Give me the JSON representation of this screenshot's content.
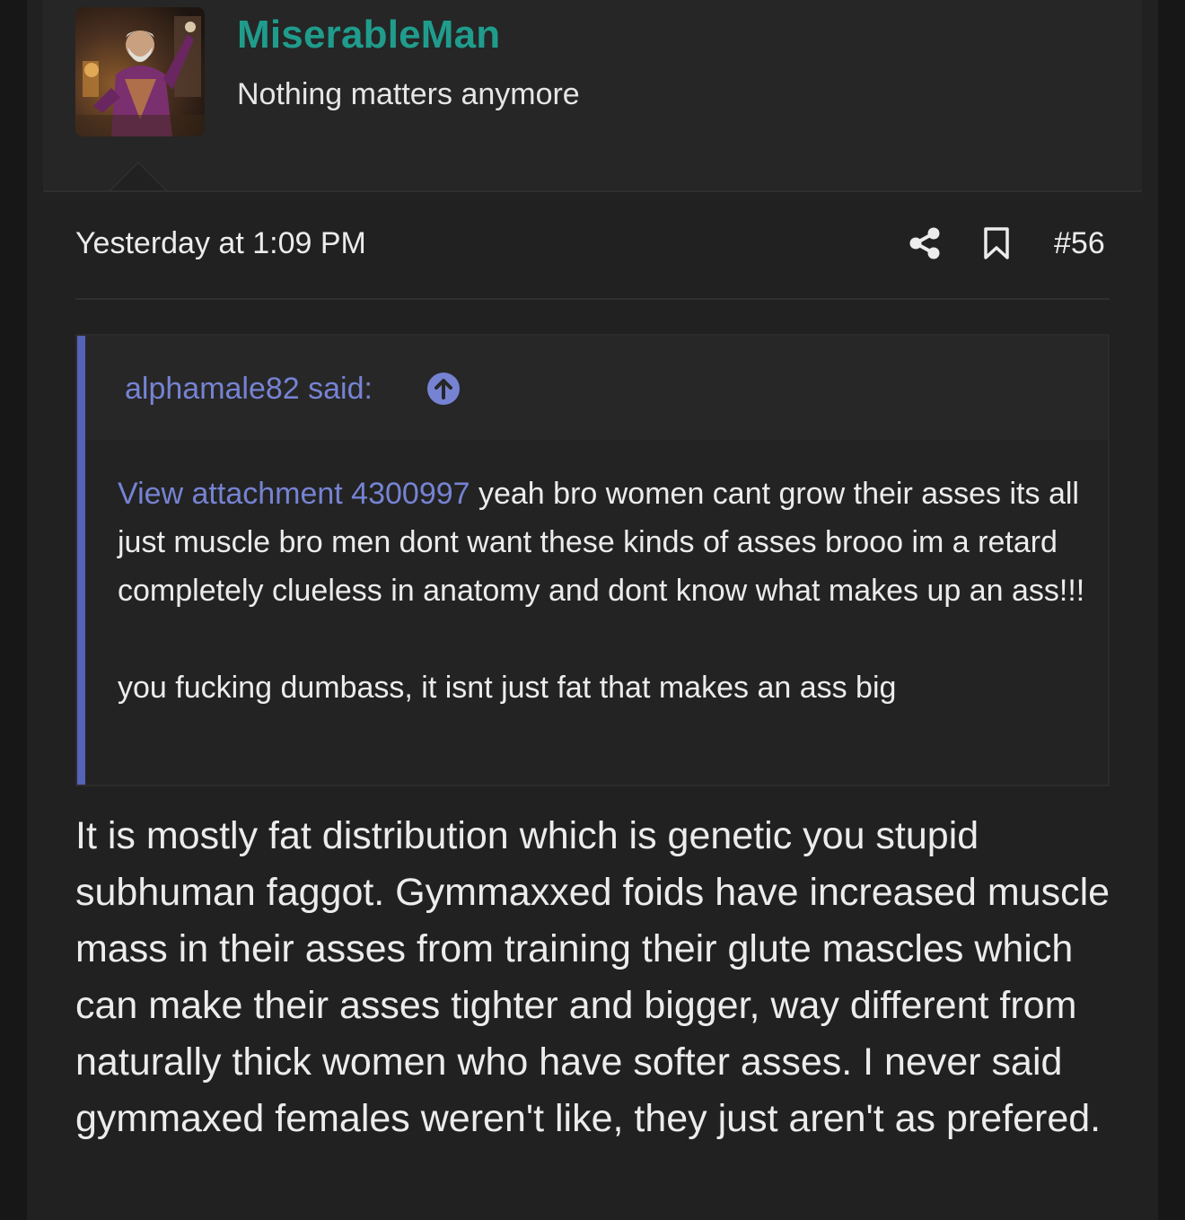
{
  "user": {
    "name": "MiserableMan",
    "title": "Nothing matters anymore",
    "avatar_icon": "user-avatar"
  },
  "post": {
    "date": "Yesterday at 1:09 PM",
    "number": "#56",
    "share_icon": "share-icon",
    "bookmark_icon": "bookmark-icon"
  },
  "quote": {
    "author": "alphamale82 said:",
    "jump_icon": "arrow-up-circle-icon",
    "attachment_link": "View attachment 4300997",
    "text_main": " yeah bro women cant grow their asses its all just muscle bro men dont want these kinds of asses brooo im a retard completely clueless in anatomy and dont know what makes up an ass!!!",
    "text_second": "you fucking dumbass, it isnt just fat that makes an ass big"
  },
  "reply": {
    "text": "It is mostly fat distribution which is genetic you stupid subhuman faggot. Gymmaxxed foids have increased muscle mass in their asses from training their glute mascles which can make their asses tighter and bigger, way different from naturally thick women who have softer asses. I never said gymmaxed females weren't like, they just aren't as prefered."
  },
  "colors": {
    "background": "#171717",
    "panel": "#212121",
    "username": "#1f9c8c",
    "link": "#7683d3",
    "quote_bar": "#5462b8",
    "text": "#ececec"
  }
}
